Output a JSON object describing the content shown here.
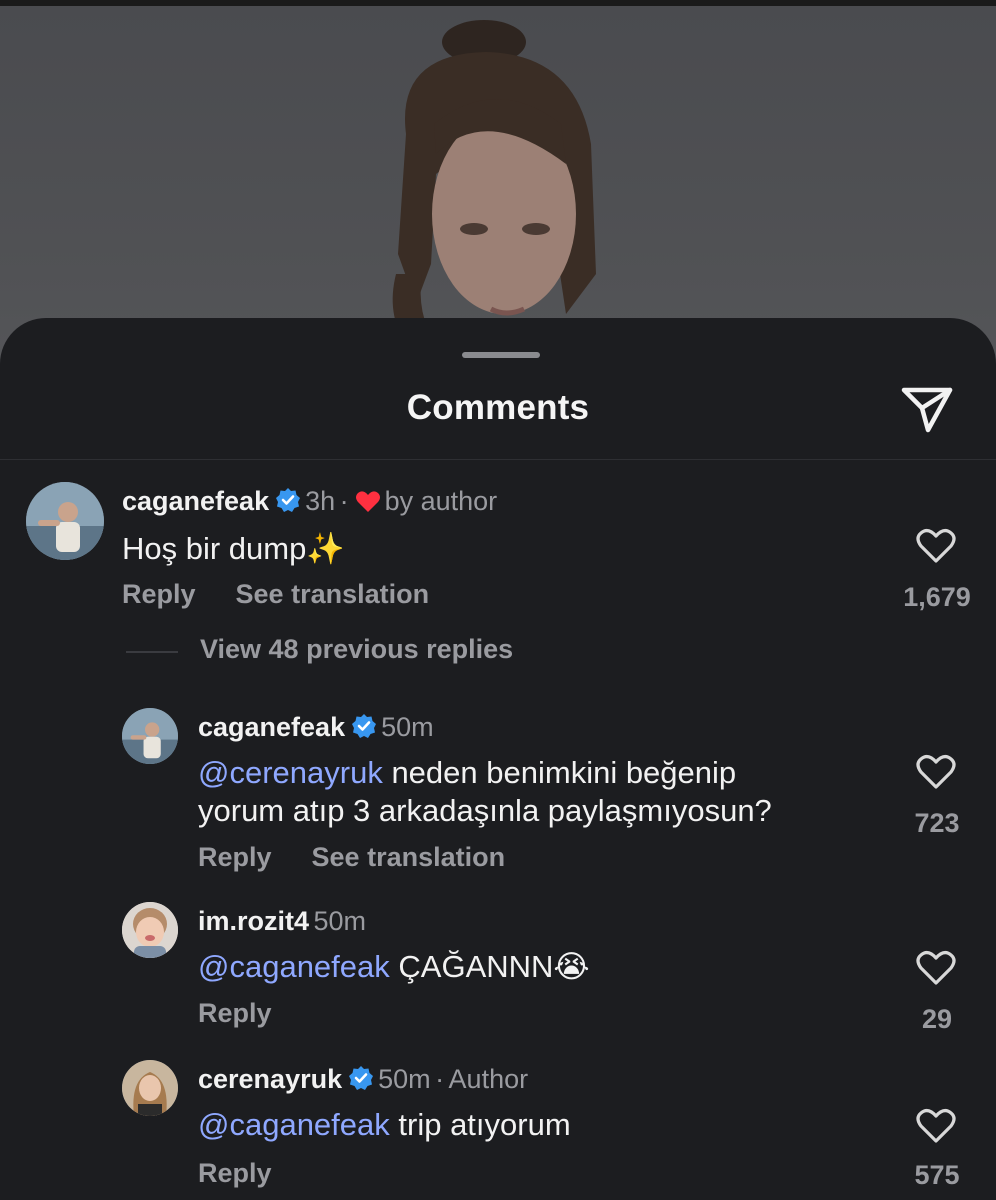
{
  "sheet": {
    "title": "Comments",
    "share_icon": "paper-plane-icon"
  },
  "comments": [
    {
      "username": "caganefeak",
      "verified": true,
      "time": "3h",
      "separator": "·",
      "liked_by_author": "by author",
      "text": "Hoş bir dump✨",
      "reply_label": "Reply",
      "translate_label": "See translation",
      "likes": "1,679"
    }
  ],
  "view_replies": "View 48 previous replies",
  "replies": [
    {
      "username": "caganefeak",
      "verified": true,
      "time": "50m",
      "mention": "@cerenayruk",
      "text_line1": " neden benimkini beğenip",
      "text_line2": "yorum atıp 3 arkadaşınla paylaşmıyosun?",
      "reply_label": "Reply",
      "translate_label": "See translation",
      "likes": "723"
    },
    {
      "username": "im.rozit4",
      "verified": false,
      "time": "50m",
      "mention": "@caganefeak",
      "text": " ÇAĞANNN😭",
      "reply_label": "Reply",
      "likes": "29"
    },
    {
      "username": "cerenayruk",
      "verified": true,
      "time": "50m",
      "separator": "·",
      "tag": "Author",
      "mention": "@caganefeak",
      "text": " trip atıyorum",
      "reply_label": "Reply",
      "likes": "575"
    }
  ],
  "colors": {
    "sheet_bg": "#1c1d20",
    "mention": "#8fa8ff",
    "verified": "#3897f0",
    "heart": "#ff3040"
  }
}
